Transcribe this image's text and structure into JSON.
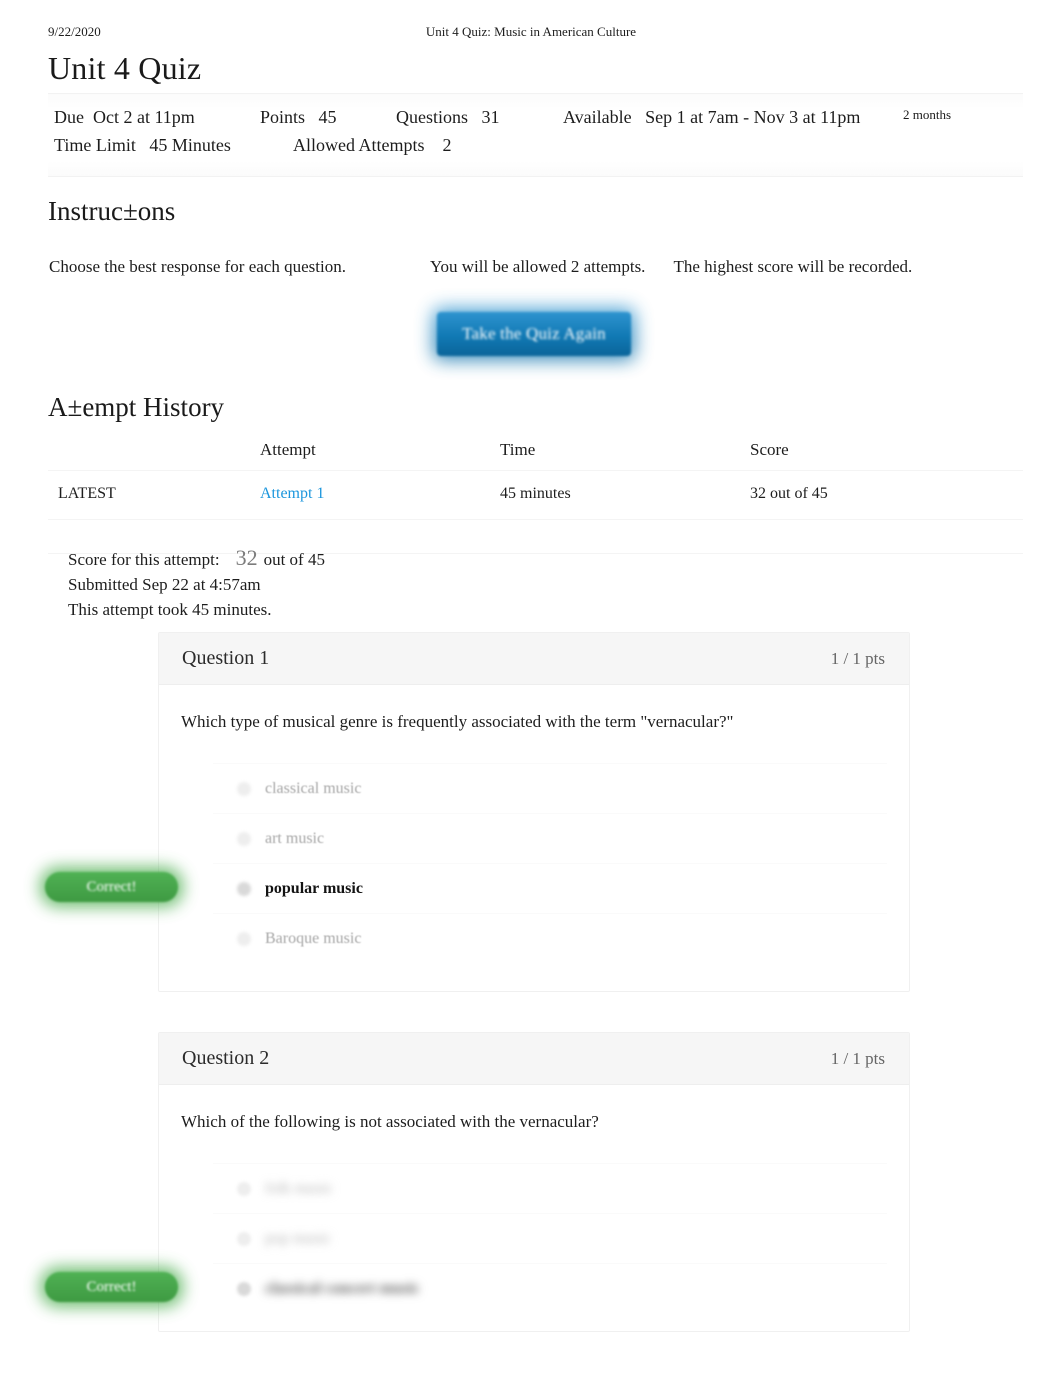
{
  "print_header": {
    "date": "9/22/2020",
    "title": "Unit 4 Quiz: Music in American Culture"
  },
  "quiz": {
    "title": "Unit 4 Quiz",
    "meta": {
      "due_label": "Due",
      "due_value": "Oct 2 at 11pm",
      "points_label": "Points",
      "points_value": "45",
      "questions_label": "Questions",
      "questions_value": "31",
      "available_label": "Available",
      "available_value": "Sep 1 at 7am - Nov 3 at 11pm",
      "duration_note": "2 months",
      "time_limit_label": "Time Limit",
      "time_limit_value": "45 Minutes",
      "allowed_attempts_label": "Allowed Attempts",
      "allowed_attempts_value": "2"
    }
  },
  "instructions": {
    "heading": "Instruc±ons",
    "line_a": "Choose the best response for each question.",
    "line_b": "You will be allowed 2 attempts.",
    "line_c": "The highest score will be recorded.",
    "take_quiz_button": "Take the Quiz Again"
  },
  "attempt_history": {
    "heading": "A±empt History",
    "columns": [
      "",
      "Attempt",
      "Time",
      "Score"
    ],
    "rows": [
      {
        "kept": "LATEST",
        "attempt": "Attempt 1",
        "time": "45 minutes",
        "score": "32 out of 45"
      }
    ]
  },
  "score_summary": {
    "score_label": "Score for this attempt:",
    "score_value": "32",
    "score_out_of": "out of 45",
    "submitted": "Submitted Sep 22 at 4:57am",
    "duration": "This attempt took 45 minutes."
  },
  "questions": [
    {
      "name": "Question 1",
      "points": "1 / 1 pts",
      "text": "Which type of musical genre is frequently associated with the term \"vernacular?\"",
      "badge": "Correct!",
      "answers": [
        {
          "label": "classical music",
          "selected": false
        },
        {
          "label": "art music",
          "selected": false
        },
        {
          "label": "popular music",
          "selected": true
        },
        {
          "label": "Baroque music",
          "selected": false
        }
      ]
    },
    {
      "name": "Question 2",
      "points": "1 / 1 pts",
      "text": "Which of the following is not associated with the vernacular?",
      "badge": "Correct!",
      "answers": [
        {
          "label": "folk music",
          "selected": false
        },
        {
          "label": "pop music",
          "selected": false
        },
        {
          "label": "classical concert music",
          "selected": true
        }
      ]
    }
  ],
  "colors": {
    "link": "#1b96dd",
    "correct_green": "#4cae4f",
    "button_blue": "#1179b4",
    "header_gray": "#f6f6f6"
  }
}
